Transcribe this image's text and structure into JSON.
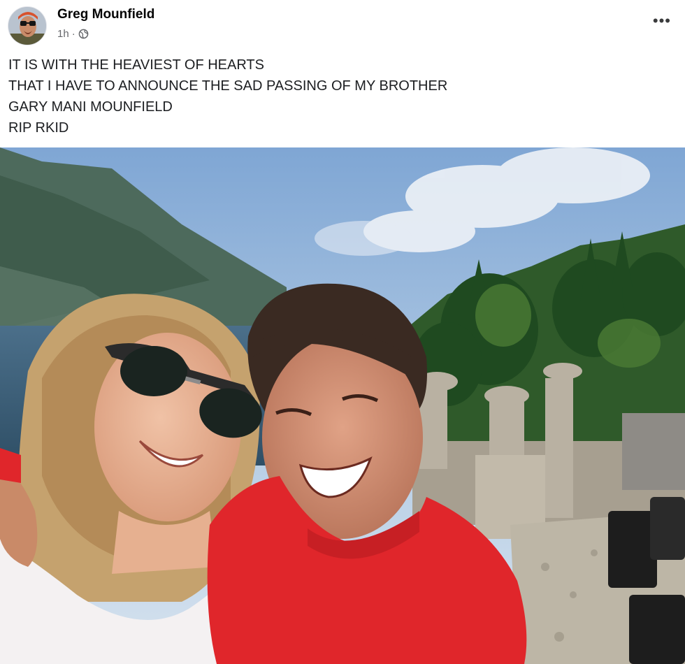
{
  "post": {
    "author_name": "Greg Mounfield",
    "timestamp": "1h",
    "separator": "·",
    "privacy_icon": "globe-icon",
    "more_icon": "ellipsis-icon",
    "more_label": "•••",
    "text_lines": [
      "IT IS WITH THE HEAVIEST OF HEARTS",
      "THAT I HAVE TO ANNOUNCE THE SAD PASSING OF MY BROTHER",
      "GARY MANI MOUNFIELD",
      "RIP RKID"
    ]
  },
  "photo": {
    "description_icon": "selfie-photo"
  },
  "colors": {
    "author_text": "#050505",
    "meta_text": "#65676b",
    "sweater_red": "#e0262b",
    "sky_blue": "#9bbbe0"
  }
}
